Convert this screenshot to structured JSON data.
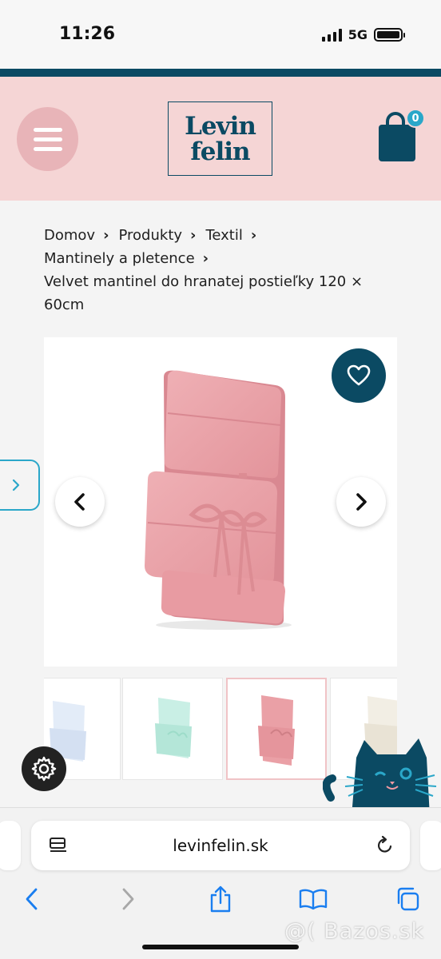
{
  "status_bar": {
    "time": "11:26",
    "network": "5G",
    "icons": [
      "signal-icon",
      "battery-icon"
    ]
  },
  "header": {
    "logo_line1": "Levin",
    "logo_line2": "felin",
    "cart_count": "0",
    "icons": [
      "menu-icon",
      "shopping-bag-icon"
    ]
  },
  "breadcrumb": {
    "items": [
      "Domov",
      "Produkty",
      "Textil",
      "Mantinely a pletence"
    ],
    "current_line1": "Velvet mantinel do hranatej postieľky 120 ×",
    "current_line2": "60cm"
  },
  "gallery": {
    "icons": [
      "heart-icon",
      "chevron-left-icon",
      "chevron-right-icon"
    ],
    "thumbnail_count": 4,
    "active_thumbnail": 3
  },
  "browser": {
    "url": "levinfelin.sk",
    "icons": [
      "reader-icon",
      "reload-icon",
      "back-icon",
      "forward-icon",
      "share-icon",
      "bookmarks-icon",
      "tabs-icon"
    ]
  },
  "watermark": "@( Bazos.sk",
  "colors": {
    "brand": "#0b4a63",
    "header_bg": "#f5d5d5",
    "accent": "#2aa7c9",
    "product_pink": "#eaa0a6"
  }
}
